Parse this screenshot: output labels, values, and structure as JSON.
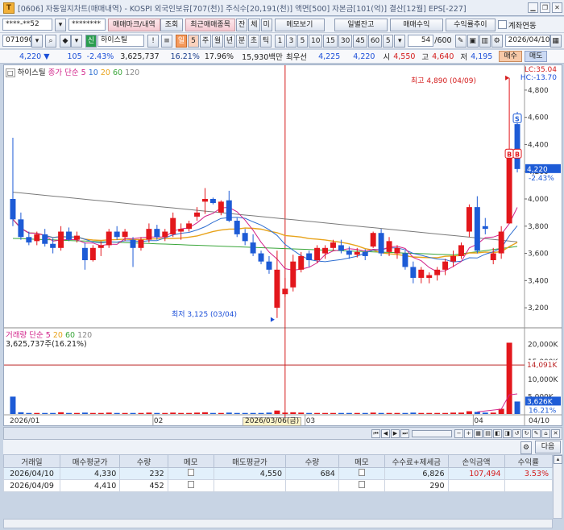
{
  "title": {
    "text": "[0606] 자동일지차트(매매내역) - KOSPI 외국인보유[707(천)] 주식수[20,191(천)] 액면[500] 자본금[101(억)] 결산[12월] EPS[-227]",
    "icon": "T"
  },
  "toolbar1": {
    "account": "****-**52",
    "password": "********",
    "btn_trades": "매매마크/내역",
    "btn_query": "조회",
    "btn_recent": "최근매매종목",
    "btn_jan": "잔",
    "btn_che": "체",
    "btn_mi": "미",
    "btn_memo": "메모보기",
    "btn_daily_balance": "일별잔고",
    "btn_trade_profit": "매매수익",
    "btn_profit_trend": "수익률추이",
    "chk_account_link": "계좌연동"
  },
  "toolbar2": {
    "code": "071090",
    "market_badge": "신",
    "name": "하이스틸",
    "period_buttons": [
      "일",
      "5",
      "주",
      "월",
      "년",
      "분",
      "초",
      "틱"
    ],
    "active_period": "일",
    "interval_buttons": [
      "1",
      "3",
      "5",
      "10",
      "15",
      "30",
      "45",
      "60",
      "5"
    ],
    "count": "54",
    "count_total": "/600",
    "date": "2026/04/10"
  },
  "quote": {
    "price": "4,220",
    "arrow": "▼",
    "change": "105",
    "change_pct": "-2.43%",
    "volume": "3,625,737",
    "turnover": "16.21%",
    "ratio": "17.96%",
    "amount": "15,930백만",
    "label_min": "최우선",
    "bid_label": "",
    "bid": "4,225",
    "ask": "4,220",
    "open_label": "시",
    "open": "4,550",
    "high_label": "고",
    "high": "4,640",
    "low_label": "저",
    "low": "4,195",
    "buy_label": "매수",
    "sell_label": "매도"
  },
  "chart_legend": {
    "stock_name": "하이스틸",
    "ma_label": "종가 단순",
    "ma_periods": [
      "5",
      "10",
      "20",
      "60",
      "120"
    ],
    "vol_label": "거래량 단순",
    "vol_periods": [
      "5",
      "20",
      "60",
      "120"
    ],
    "vol_info": "3,625,737주(16.21%)",
    "lc": "LC:35.04",
    "hc": "HC:-13.70",
    "high_annot": "최고 4,890 (04/09)",
    "low_annot": "최저 3,125 (03/04)",
    "crosshair_date": "2026/03/06(금)",
    "price_tag": "4,220",
    "price_tag_pct": "-2.43%",
    "vol_tag": "14,091K",
    "vol_tag2": "3,626K",
    "vol_tag_pct": "16.21%",
    "marker_sell": "S",
    "marker_buy": "B"
  },
  "colors": {
    "up": "#e3171c",
    "down": "#1d5bd6",
    "ma5": "#d2238a",
    "ma10": "#2f6fd1",
    "ma20": "#e8a31b",
    "ma60": "#3aa63a",
    "ma120": "#7a7a7a"
  },
  "chart_data": {
    "type": "candlestick",
    "price_axis": [
      "4,800",
      "4,600",
      "4,400",
      "4,200",
      "4,000",
      "3,800",
      "3,600",
      "3,400",
      "3,200"
    ],
    "volume_axis": [
      "20,000K",
      "15,000K",
      "10,000K",
      "5,000K"
    ],
    "x_labels": [
      "2026/01",
      "02",
      "03",
      "04",
      "04/10"
    ],
    "ylim": [
      3100,
      4900
    ],
    "candles": [
      [
        4000,
        4450,
        3800,
        3850
      ],
      [
        3850,
        3900,
        3700,
        3720
      ],
      [
        3720,
        3760,
        3660,
        3680
      ],
      [
        3690,
        3760,
        3660,
        3740
      ],
      [
        3740,
        3780,
        3650,
        3670
      ],
      [
        3670,
        3710,
        3600,
        3640
      ],
      [
        3640,
        3800,
        3620,
        3760
      ],
      [
        3760,
        3790,
        3690,
        3700
      ],
      [
        3700,
        3760,
        3680,
        3730
      ],
      [
        3640,
        3680,
        3480,
        3550
      ],
      [
        3550,
        3660,
        3540,
        3640
      ],
      [
        3640,
        3690,
        3580,
        3660
      ],
      [
        3660,
        3780,
        3640,
        3760
      ],
      [
        3760,
        3800,
        3700,
        3720
      ],
      [
        3720,
        3780,
        3690,
        3760
      ],
      [
        3700,
        3720,
        3500,
        3640
      ],
      [
        3640,
        3720,
        3620,
        3700
      ],
      [
        3700,
        3820,
        3680,
        3780
      ],
      [
        3780,
        3810,
        3700,
        3720
      ],
      [
        3720,
        3780,
        3690,
        3760
      ],
      [
        3740,
        3900,
        3720,
        3860
      ],
      [
        3760,
        3820,
        3700,
        3780
      ],
      [
        3780,
        3840,
        3760,
        3820
      ],
      [
        3870,
        3940,
        3840,
        3900
      ],
      [
        3980,
        4080,
        3890,
        4000
      ],
      [
        4000,
        4010,
        3960,
        3970
      ],
      [
        3900,
        3990,
        3880,
        3980
      ],
      [
        3990,
        4060,
        3830,
        3840
      ],
      [
        3840,
        3860,
        3720,
        3740
      ],
      [
        3750,
        3780,
        3660,
        3690
      ],
      [
        3680,
        3740,
        3580,
        3600
      ],
      [
        3600,
        3620,
        3520,
        3540
      ],
      [
        3540,
        3580,
        3450,
        3480
      ],
      [
        3200,
        3620,
        3125,
        3480
      ],
      [
        3300,
        3420,
        3280,
        3340
      ],
      [
        3350,
        3590,
        3320,
        3540
      ],
      [
        3480,
        3610,
        3460,
        3580
      ],
      [
        3600,
        3620,
        3500,
        3550
      ],
      [
        3550,
        3660,
        3530,
        3640
      ],
      [
        3600,
        3660,
        3560,
        3640
      ],
      [
        3640,
        3700,
        3620,
        3680
      ],
      [
        3660,
        3700,
        3600,
        3620
      ],
      [
        3620,
        3650,
        3560,
        3590
      ],
      [
        3590,
        3640,
        3570,
        3610
      ],
      [
        3610,
        3630,
        3550,
        3580
      ],
      [
        3650,
        3760,
        3640,
        3750
      ],
      [
        3750,
        3780,
        3580,
        3600
      ],
      [
        3610,
        3720,
        3580,
        3690
      ],
      [
        3600,
        3660,
        3560,
        3640
      ],
      [
        3600,
        3620,
        3480,
        3500
      ],
      [
        3500,
        3540,
        3380,
        3420
      ],
      [
        3420,
        3500,
        3380,
        3480
      ],
      [
        3420,
        3460,
        3380,
        3440
      ],
      [
        3440,
        3500,
        3400,
        3480
      ],
      [
        3480,
        3560,
        3440,
        3540
      ],
      [
        3540,
        3620,
        3500,
        3580
      ],
      [
        3580,
        3680,
        3560,
        3660
      ],
      [
        3760,
        3960,
        3720,
        3940
      ],
      [
        3940,
        4020,
        3600,
        3620
      ],
      [
        3800,
        3860,
        3740,
        3780
      ],
      [
        3550,
        3640,
        3520,
        3600
      ],
      [
        3600,
        3800,
        3560,
        3760
      ],
      [
        3820,
        4890,
        3820,
        4330
      ],
      [
        4550,
        4640,
        4195,
        4220
      ]
    ],
    "volumes": [
      5,
      0.5,
      0.3,
      0.3,
      0.3,
      0.3,
      0.5,
      0.3,
      0.3,
      0.4,
      0.3,
      0.3,
      0.4,
      0.3,
      0.3,
      0.3,
      0.3,
      0.4,
      0.3,
      0.3,
      0.4,
      0.3,
      0.3,
      0.4,
      0.5,
      0.3,
      0.3,
      0.4,
      0.3,
      0.3,
      0.3,
      0.3,
      0.4,
      1.0,
      0.4,
      0.5,
      0.4,
      0.3,
      0.3,
      0.3,
      0.3,
      0.3,
      0.3,
      0.3,
      0.3,
      0.4,
      0.3,
      0.3,
      0.3,
      0.3,
      0.4,
      0.3,
      0.3,
      0.3,
      0.3,
      0.4,
      0.4,
      0.8,
      0.6,
      0.4,
      0.4,
      1.5,
      20.5,
      3.6
    ]
  },
  "grid": {
    "headers": [
      "거래일",
      "매수평균가",
      "수량",
      "메모",
      "매도평균가",
      "수량",
      "메모",
      "수수료+제세금",
      "손익금액",
      "수익률"
    ],
    "rows": [
      [
        "2026/04/10",
        "4,330",
        "232",
        "",
        "4,550",
        "684",
        "",
        "6,826",
        "107,494",
        "3.53%"
      ],
      [
        "2026/04/09",
        "4,410",
        "452",
        "",
        "",
        "",
        "",
        "290",
        "",
        ""
      ]
    ],
    "next_btn": "다음"
  }
}
